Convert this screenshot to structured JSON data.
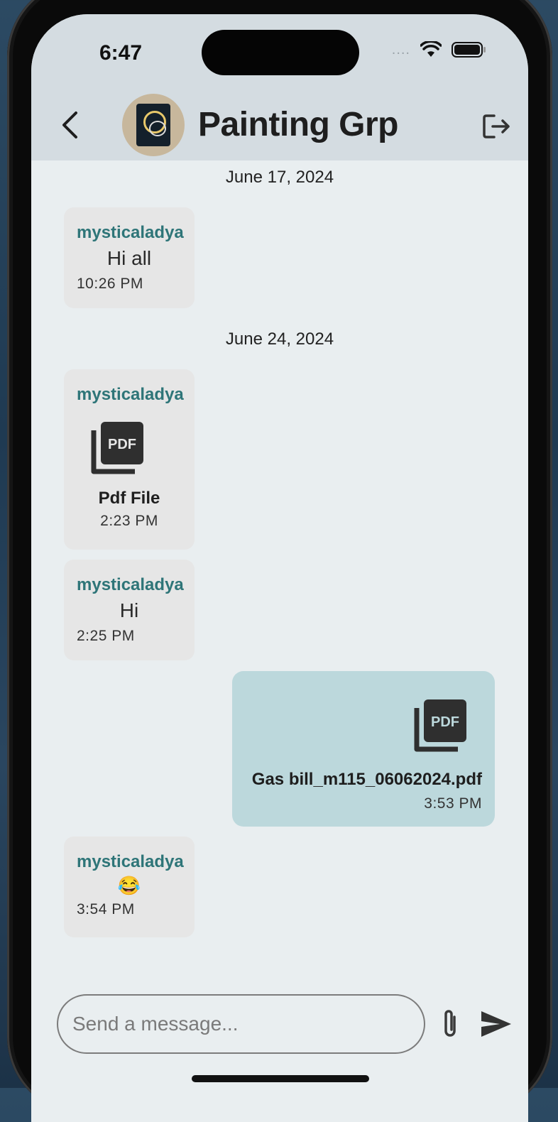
{
  "status_bar": {
    "time": "6:47",
    "signal": "....",
    "icons": [
      "signal-dots-icon",
      "wifi-icon",
      "battery-icon"
    ]
  },
  "header": {
    "title": "Painting Grp",
    "back_icon": "chevron-left-icon",
    "leave_icon": "logout-icon"
  },
  "conversation": {
    "date_1": "June 17, 2024",
    "date_2": "June 24, 2024",
    "messages": [
      {
        "sender": "mysticaladya",
        "text": "Hi all",
        "time": "10:26 PM",
        "direction": "incoming"
      },
      {
        "sender": "mysticaladya",
        "attachment_type": "pdf",
        "file_label": "Pdf File",
        "time": "2:23 PM",
        "direction": "incoming"
      },
      {
        "sender": "mysticaladya",
        "text": "Hi",
        "time": "2:25 PM",
        "direction": "incoming"
      },
      {
        "attachment_type": "pdf",
        "file_label": "Gas bill_m115_06062024.pdf",
        "time": "3:53 PM",
        "direction": "outgoing"
      },
      {
        "sender": "mysticaladya",
        "text": "😂",
        "time": "3:54 PM",
        "direction": "incoming"
      }
    ]
  },
  "composer": {
    "placeholder": "Send a message...",
    "attach_icon": "paperclip-icon",
    "send_icon": "send-icon"
  },
  "colors": {
    "sender_name": "#2e7578",
    "incoming_bubble": "#e6e6e6",
    "outgoing_bubble": "#bcd8dc",
    "header_bg": "#d4dce1",
    "chat_bg": "#e9eef0"
  }
}
